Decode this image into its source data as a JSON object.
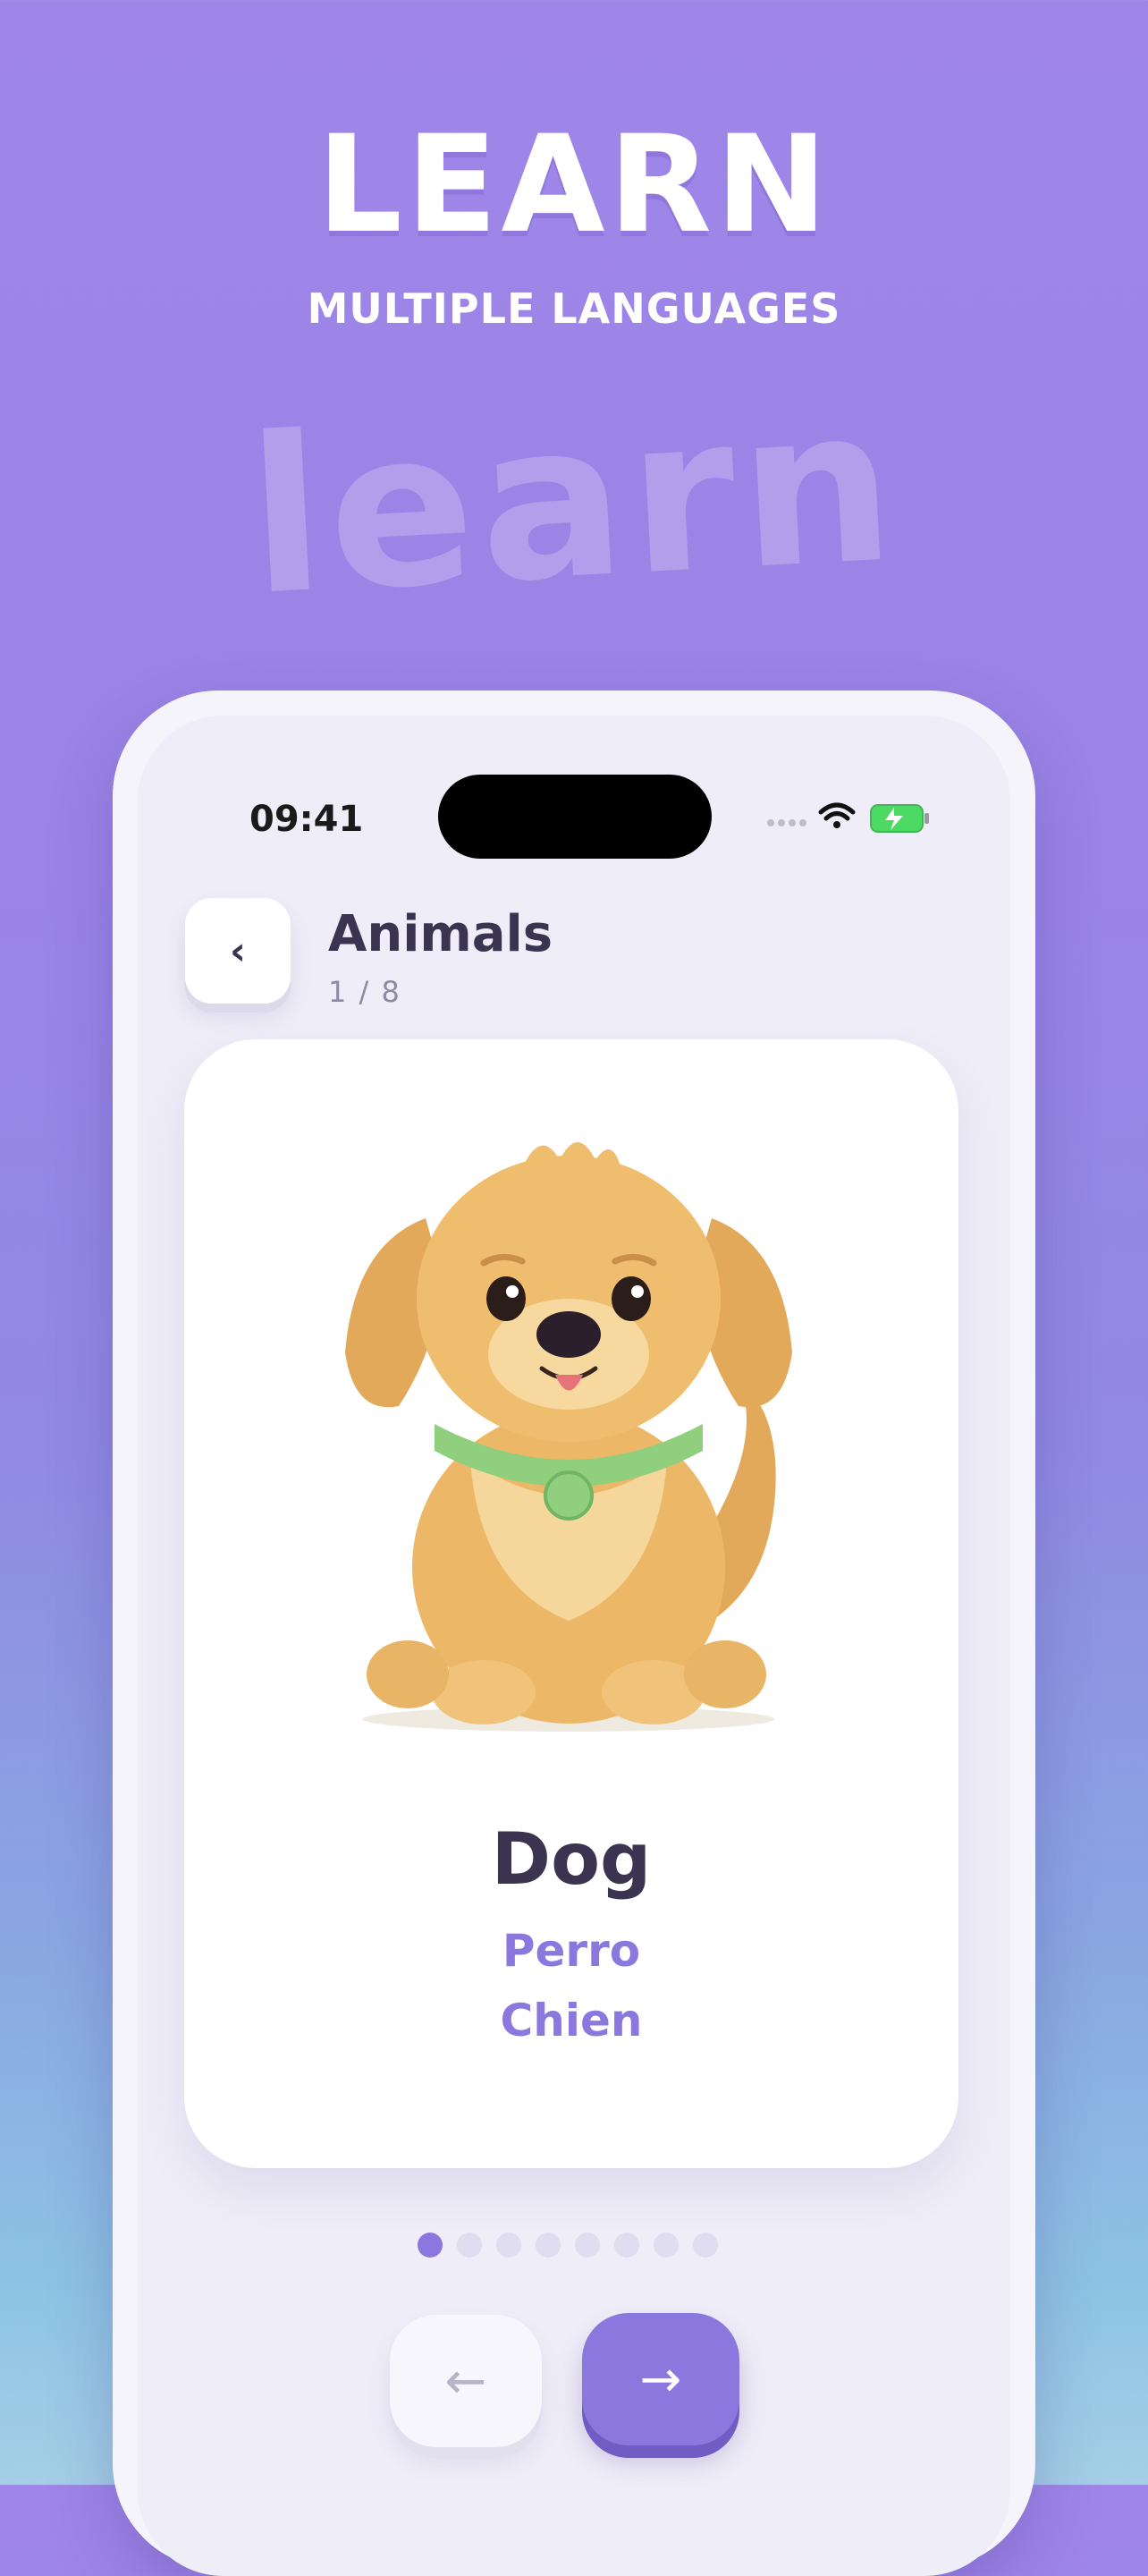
{
  "hero": {
    "title": "LEARN",
    "subtitle": "MULTIPLE LANGUAGES",
    "watermark": "learn"
  },
  "status_bar": {
    "time": "09:41",
    "icons": [
      "cellular-dots-icon",
      "wifi-icon",
      "battery-charging-icon"
    ]
  },
  "header": {
    "back_icon": "‹",
    "title": "Animals",
    "progress": "1 / 8"
  },
  "card": {
    "image": "dog-illustration",
    "word": "Dog",
    "translations": [
      "Perro",
      "Chien"
    ]
  },
  "pagination": {
    "total": 8,
    "current": 1
  },
  "nav": {
    "prev_icon": "←",
    "next_icon": "→"
  },
  "colors": {
    "accent": "#8b78df",
    "text_dark": "#3a3450",
    "background_top": "#9f85e8",
    "background_bottom": "#a4cfe6",
    "battery_green": "#4cd964"
  }
}
